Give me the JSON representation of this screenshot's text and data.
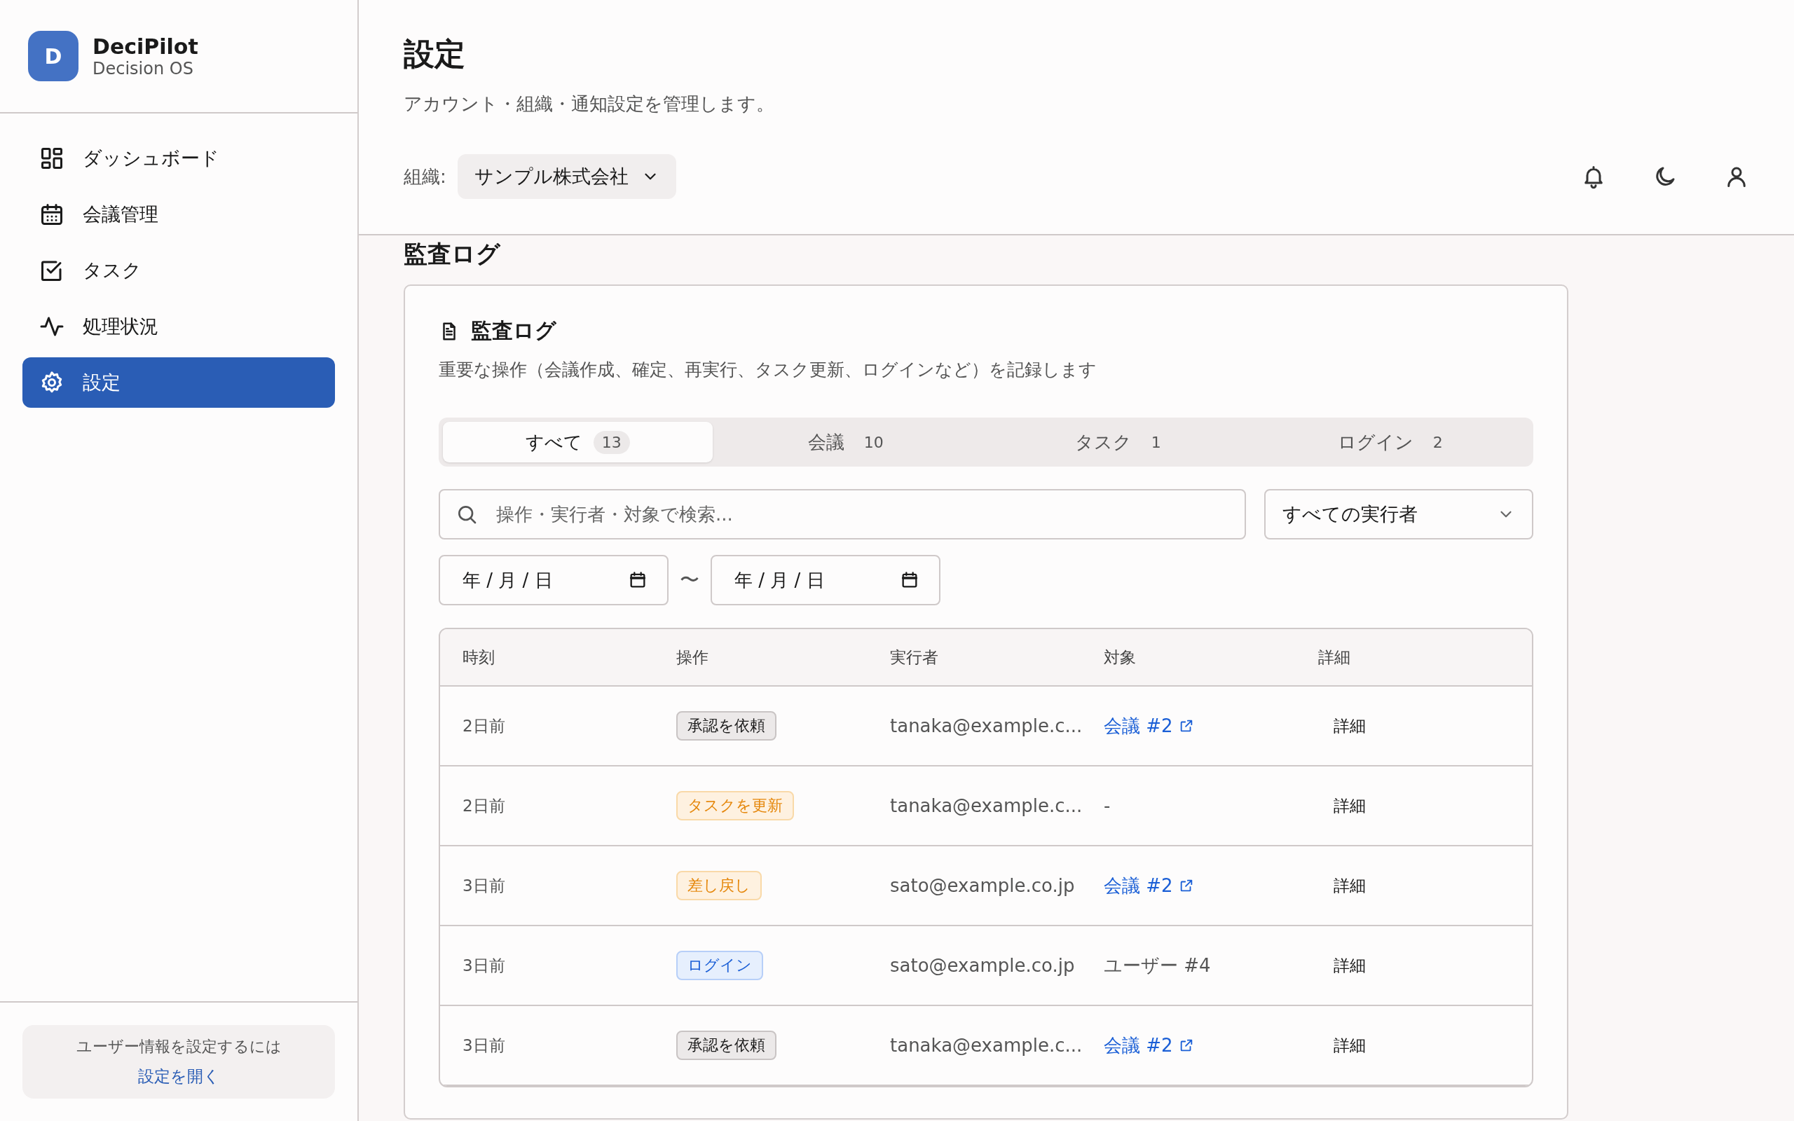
{
  "brand": {
    "logo_letter": "D",
    "name": "DeciPilot",
    "subtitle": "Decision OS"
  },
  "nav": [
    {
      "label": "ダッシュボード",
      "kind": "dashboard",
      "selected": false
    },
    {
      "label": "会議管理",
      "kind": "meetings",
      "selected": false
    },
    {
      "label": "タスク",
      "kind": "tasks",
      "selected": false
    },
    {
      "label": "処理状況",
      "kind": "status",
      "selected": false
    },
    {
      "label": "設定",
      "kind": "settings",
      "selected": true
    }
  ],
  "sidebar_footer": {
    "text": "ユーザー情報を設定するには",
    "link": "設定を開く"
  },
  "header": {
    "title": "設定",
    "subtitle": "アカウント・組織・通知設定を管理します。",
    "org_label": "組織:",
    "org_value": "サンプル株式会社"
  },
  "section_title": "監査ログ",
  "card": {
    "title": "監査ログ",
    "description": "重要な操作（会議作成、確定、再実行、タスク更新、ログインなど）を記録します",
    "tabs": [
      {
        "label": "すべて",
        "count": "13",
        "selected": true
      },
      {
        "label": "会議",
        "count": "10",
        "selected": false
      },
      {
        "label": "タスク",
        "count": "1",
        "selected": false
      },
      {
        "label": "ログイン",
        "count": "2",
        "selected": false
      }
    ],
    "search": {
      "placeholder": "操作・実行者・対象で検索..."
    },
    "actor_filter": {
      "value": "すべての実行者"
    },
    "date_from": {
      "value": "年 / 月 / 日"
    },
    "date_separator": "〜",
    "date_to": {
      "value": "年 / 月 / 日"
    },
    "table": {
      "columns": [
        "時刻",
        "操作",
        "実行者",
        "対象",
        "詳細"
      ],
      "rows": [
        {
          "time": "2日前",
          "action": {
            "label": "承認を依頼",
            "kind": "neutral"
          },
          "actor": "tanaka@example.c...",
          "target": {
            "label": "会議 #2",
            "kind": "link"
          },
          "detail": "詳細"
        },
        {
          "time": "2日前",
          "action": {
            "label": "タスクを更新",
            "kind": "warning"
          },
          "actor": "tanaka@example.c...",
          "target": {
            "label": "-",
            "kind": "text"
          },
          "detail": "詳細"
        },
        {
          "time": "3日前",
          "action": {
            "label": "差し戻し",
            "kind": "warning"
          },
          "actor": "sato@example.co.jp",
          "target": {
            "label": "会議 #2",
            "kind": "link"
          },
          "detail": "詳細"
        },
        {
          "time": "3日前",
          "action": {
            "label": "ログイン",
            "kind": "info"
          },
          "actor": "sato@example.co.jp",
          "target": {
            "label": "ユーザー #4",
            "kind": "text"
          },
          "detail": "詳細"
        },
        {
          "time": "3日前",
          "action": {
            "label": "承認を依頼",
            "kind": "neutral"
          },
          "actor": "tanaka@example.c...",
          "target": {
            "label": "会議 #2",
            "kind": "link"
          },
          "detail": "詳細"
        }
      ]
    }
  }
}
